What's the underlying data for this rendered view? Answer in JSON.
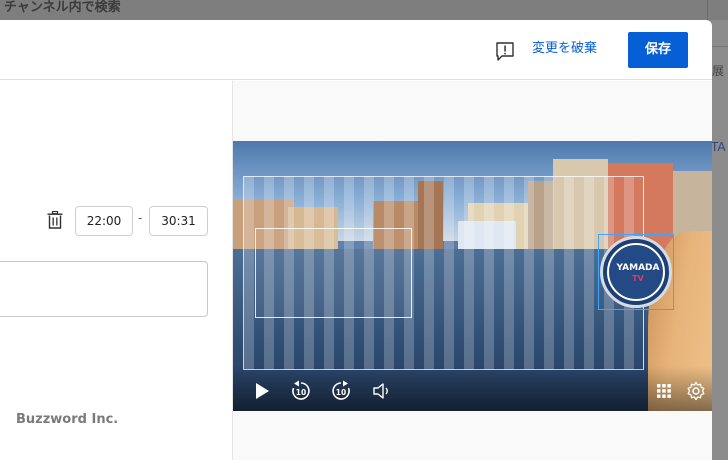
{
  "background": {
    "search_placeholder": "チャンネル内で検索",
    "right_fragment_1": "展",
    "right_fragment_2": "TA"
  },
  "header": {
    "discard_label": "変更を破棄",
    "save_label": "保存"
  },
  "editor": {
    "start_time": "22:00",
    "time_separator": "-",
    "end_time": "30:31",
    "text_field_value": ""
  },
  "footer": {
    "company": "Buzzword Inc."
  },
  "video": {
    "logo_text": "YAMADA",
    "logo_sub": "TV"
  },
  "colors": {
    "accent": "#065fd4",
    "selection": "#3ea6ff"
  }
}
